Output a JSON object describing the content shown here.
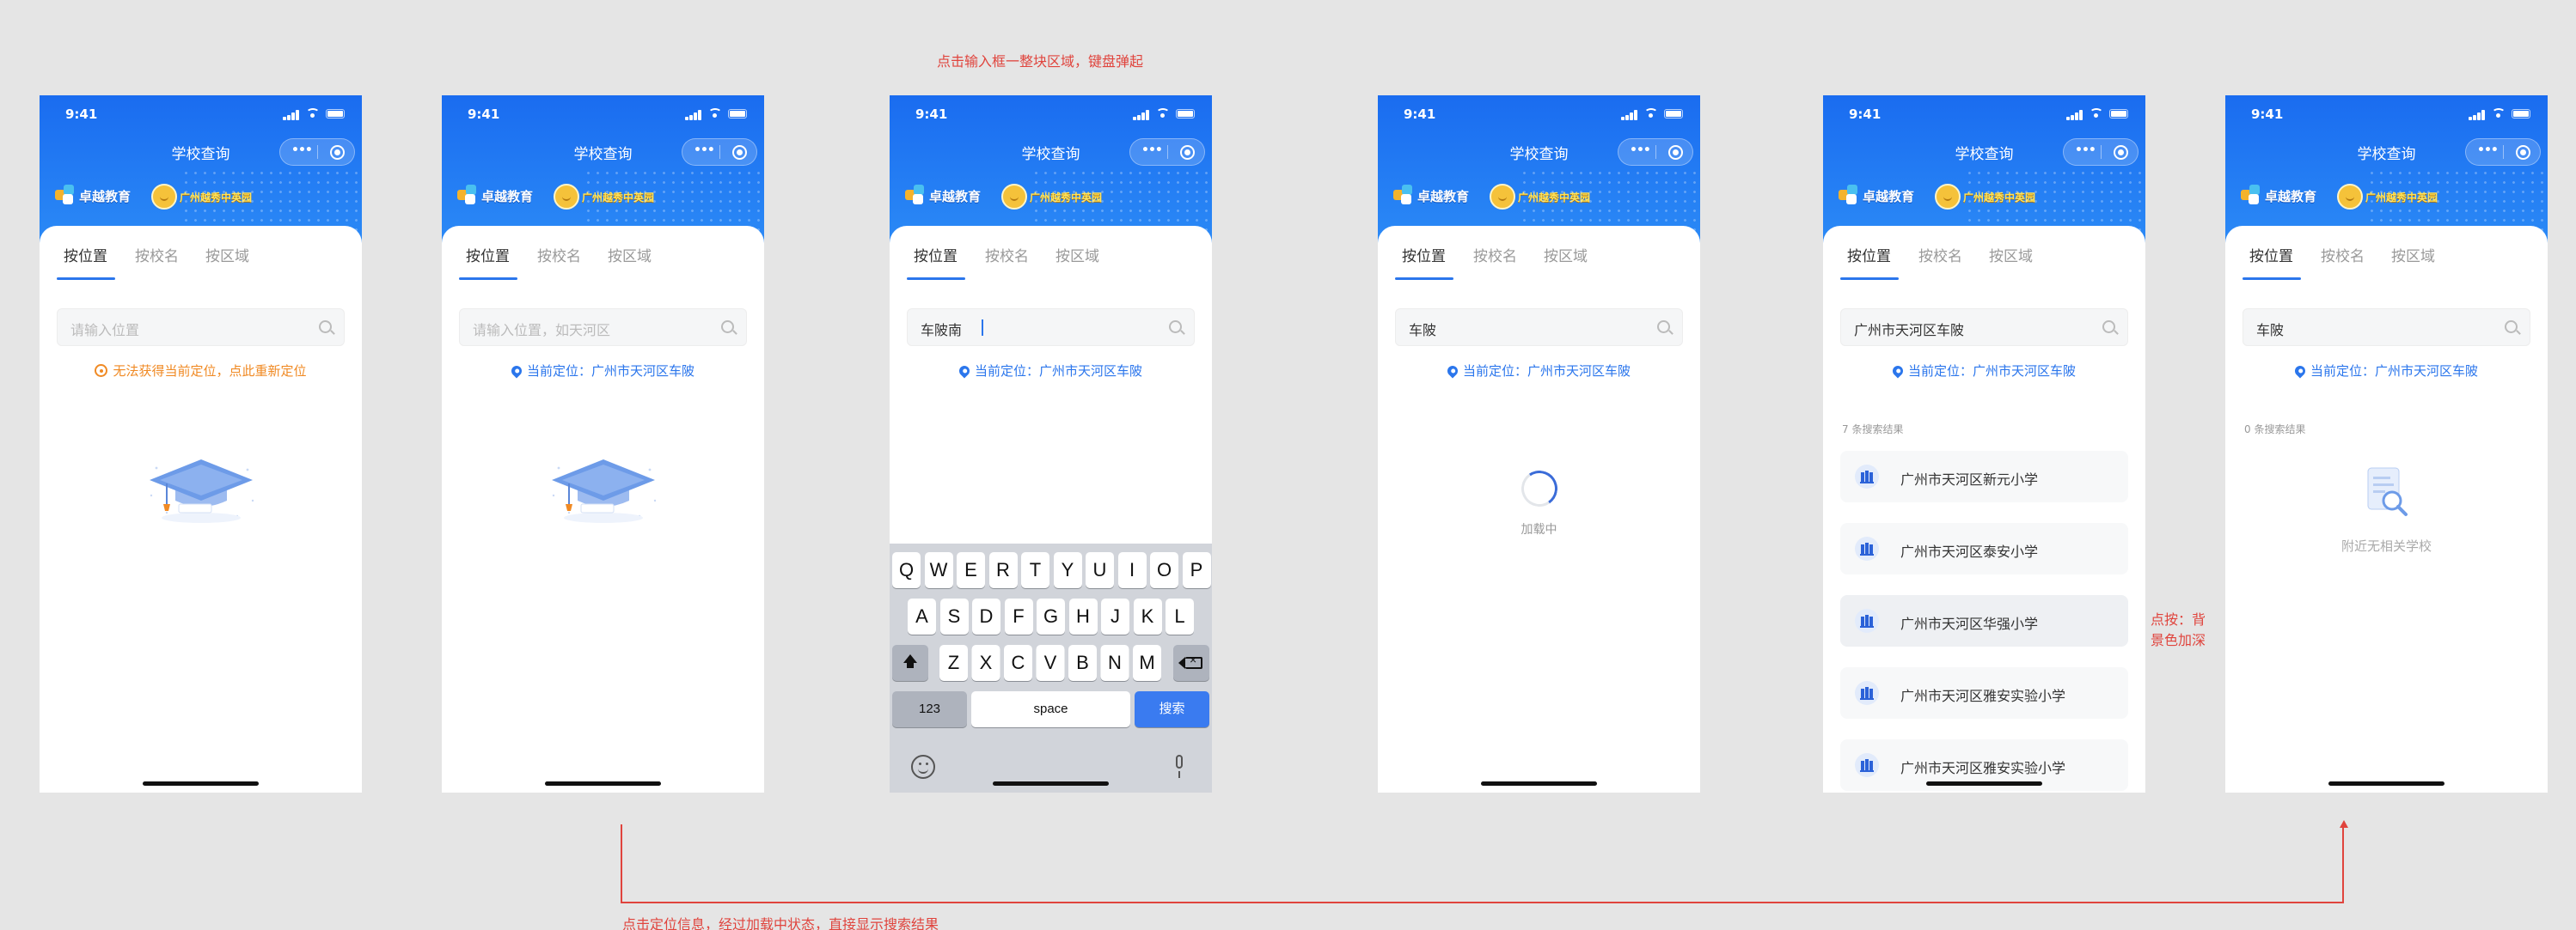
{
  "status": {
    "time": "9:41"
  },
  "nav": {
    "title": "学校查询"
  },
  "brand": {
    "name": "卓越教育",
    "badge_text": "广州越秀中英园"
  },
  "tabs": [
    "按位置",
    "按校名",
    "按区域"
  ],
  "annotations": {
    "top": "点击输入框一整块区域，键盘弹起",
    "side": "点按：背\n景色加深",
    "bottom": "点击定位信息，经过加载中状态，直接显示搜索结果"
  },
  "screens": [
    {
      "search_text": "",
      "placeholder": "请输入位置",
      "location_text": "无法获得当前定位，点此重新定位",
      "location_state": "error"
    },
    {
      "search_text": "",
      "placeholder": "请输入位置，如天河区",
      "location_text": "当前定位：广州市天河区车陂",
      "location_state": "ok"
    },
    {
      "search_text": "车陂南",
      "placeholder": "",
      "location_text": "当前定位：广州市天河区车陂",
      "location_state": "ok"
    },
    {
      "search_text": "车陂",
      "placeholder": "",
      "location_text": "当前定位：广州市天河区车陂",
      "location_state": "ok",
      "loading_text": "加载中"
    },
    {
      "search_text": "广州市天河区车陂",
      "placeholder": "",
      "location_text": "当前定位：广州市天河区车陂",
      "location_state": "ok",
      "result_count": "7 条搜索结果",
      "results": [
        "广州市天河区新元小学",
        "广州市天河区泰安小学",
        "广州市天河区华强小学",
        "广州市天河区雅安实验小学",
        "广州市天河区雅安实验小学"
      ]
    },
    {
      "search_text": "车陂",
      "placeholder": "",
      "location_text": "当前定位：广州市天河区车陂",
      "location_state": "ok",
      "result_count": "0 条搜索结果",
      "empty_text": "附近无相关学校"
    }
  ],
  "keyboard": {
    "row1": [
      "Q",
      "W",
      "E",
      "R",
      "T",
      "Y",
      "U",
      "I",
      "O",
      "P"
    ],
    "row2": [
      "A",
      "S",
      "D",
      "F",
      "G",
      "H",
      "J",
      "K",
      "L"
    ],
    "row3": [
      "Z",
      "X",
      "C",
      "V",
      "B",
      "N",
      "M"
    ],
    "numbers_key": "123",
    "space_key": "space",
    "search_key": "搜索"
  },
  "colors": {
    "primary": "#2b76ec",
    "header_gradient_top": "#1a6cf0",
    "warning": "#f08a24",
    "annotation": "#e0443d"
  }
}
